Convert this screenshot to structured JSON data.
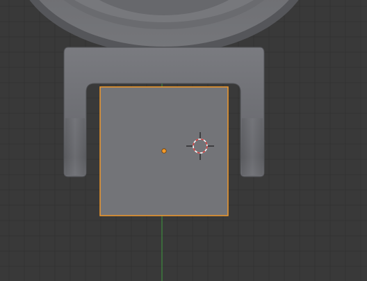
{
  "viewport": {
    "view": "top",
    "background_color": "#393939",
    "grid_minor_color": "#333333",
    "grid_major_color": "#2d2d2d",
    "y_axis_color": "#3e9a3e"
  },
  "scene": {
    "mesh_color": "#6e6f73",
    "mesh_highlight": "#8a8b8f",
    "selected_outline_color": "#f39a2a",
    "origin_color": "#f39a2a",
    "cursor_ring_colors": [
      "#d43a3a",
      "#ffffff"
    ],
    "objects": [
      {
        "name": "ring-body",
        "selected": false
      },
      {
        "name": "bracket-arm",
        "selected": false
      },
      {
        "name": "cube",
        "selected": true
      }
    ]
  },
  "icons": {
    "cursor": "3d-cursor-icon",
    "origin": "object-origin-icon"
  }
}
